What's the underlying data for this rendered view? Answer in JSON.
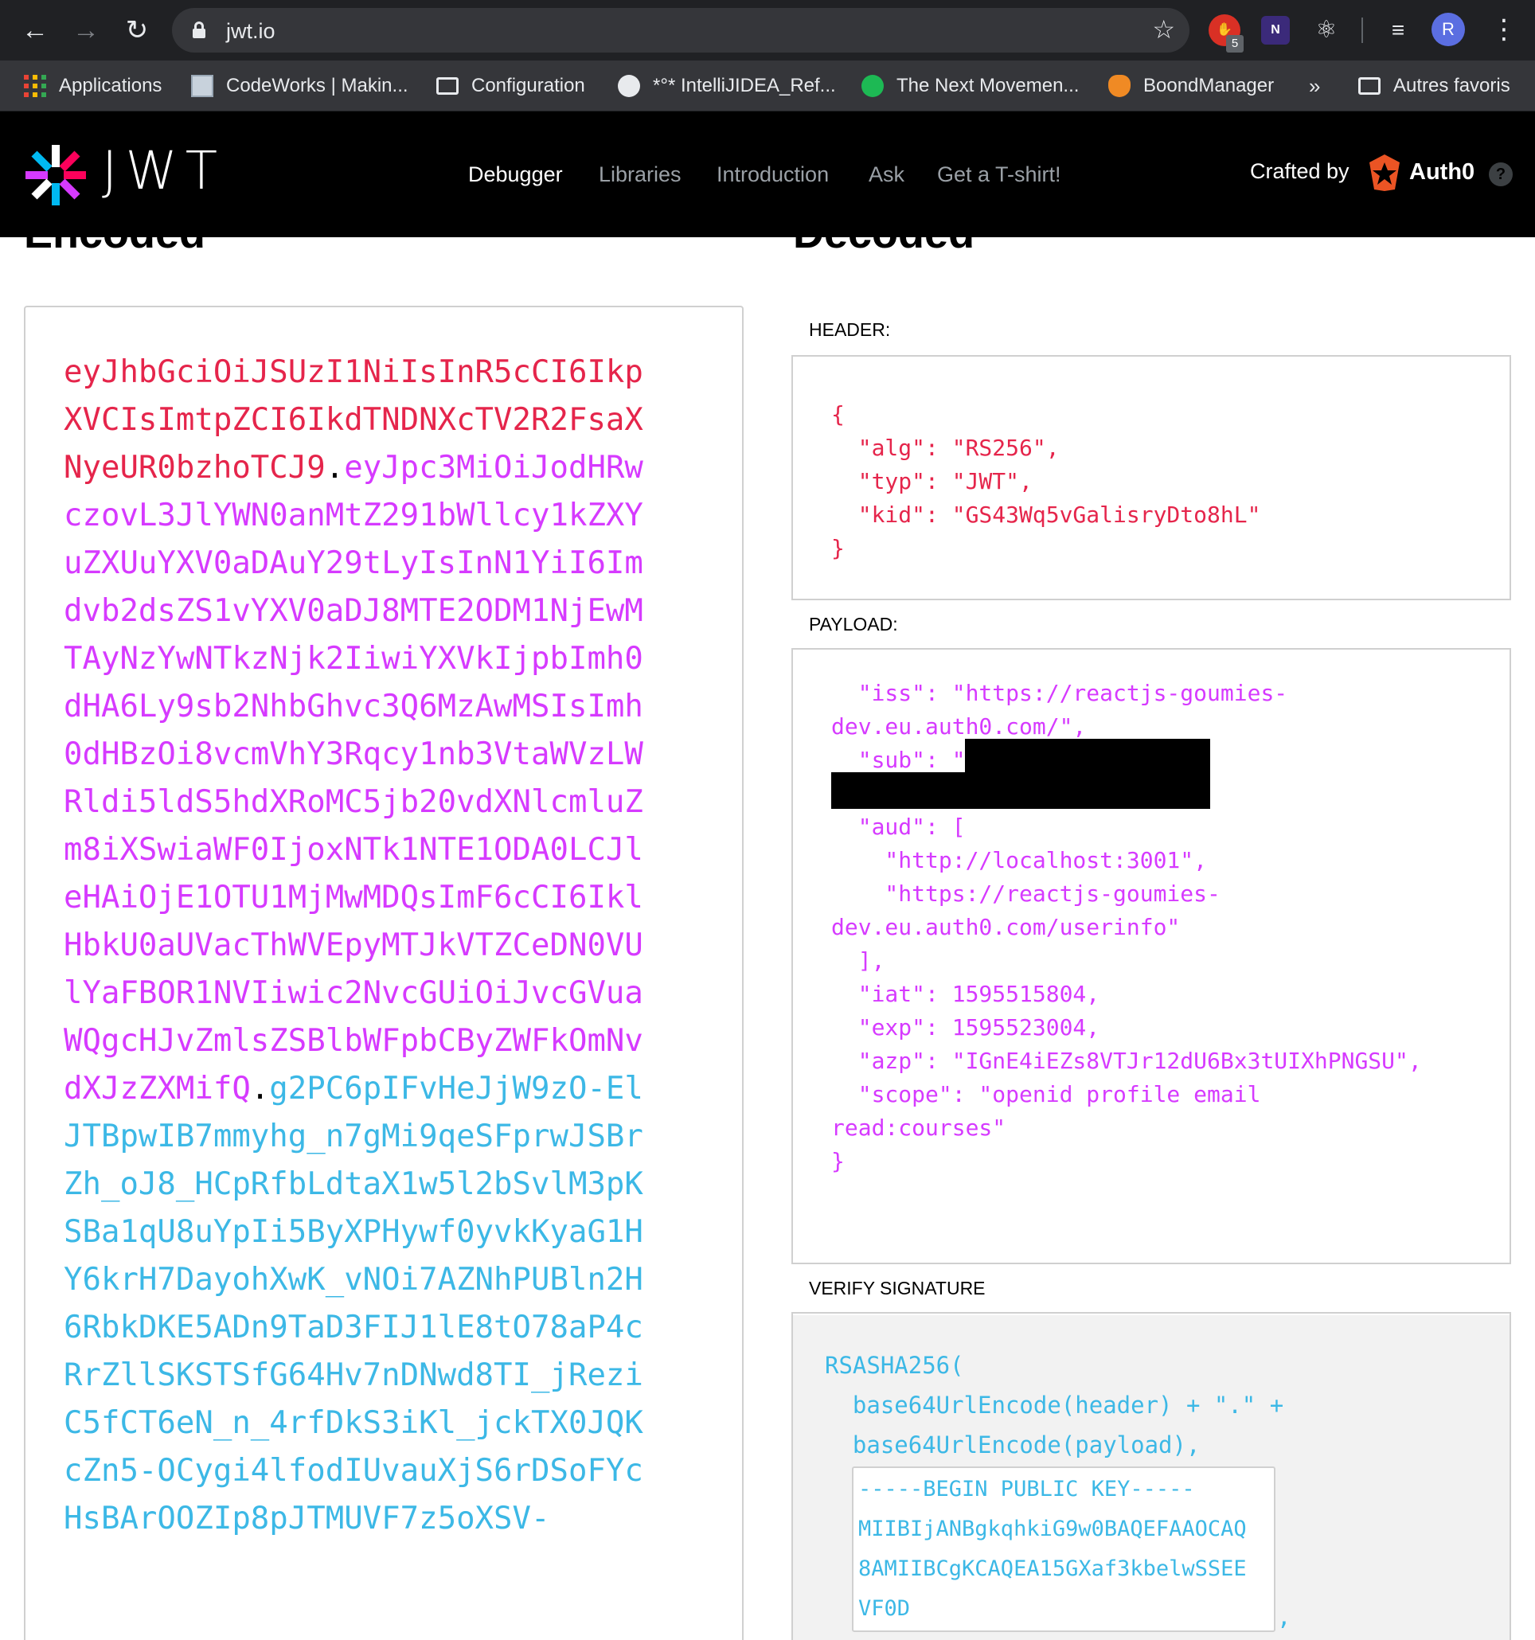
{
  "browser": {
    "url": "jwt.io",
    "extension_badge": "5",
    "avatar_letter": "R",
    "back_glyph": "←",
    "forward_glyph": "→",
    "reload_glyph": "↻",
    "star_glyph": "☆",
    "kebab_glyph": "⋮",
    "overflow_glyph": "»"
  },
  "bookmarks": [
    {
      "label": "Applications",
      "icon": "apps-grid-icon"
    },
    {
      "label": "CodeWorks | Makin...",
      "icon": "site-thumbnail-icon"
    },
    {
      "label": "Configuration",
      "icon": "folder-icon"
    },
    {
      "label": "*°* IntelliJIDEA_Ref...",
      "icon": "globe-icon"
    },
    {
      "label": "The Next Movemen...",
      "icon": "spotify-icon"
    },
    {
      "label": "BoondManager",
      "icon": "fox-icon"
    },
    {
      "label": "Autres favoris",
      "icon": "folder-icon"
    }
  ],
  "site": {
    "logo_text": "JWT",
    "nav": [
      "Debugger",
      "Libraries",
      "Introduction",
      "Ask",
      "Get a T-shirt!"
    ],
    "active_nav": "Debugger",
    "crafted_by": "Crafted by",
    "brand": "Auth0",
    "help_glyph": "?"
  },
  "encoded": {
    "title": "Encoded",
    "header_part": "eyJhbGciOiJSUzI1NiIsInR5cCI6IkpXVCIsImtpZCI6IkdTNDNXcTV2R2FsaXNyeUR0bzhoTCJ9",
    "payload_part": "eyJpc3MiOiJodHRwczovL3JlYWN0anMtZ291bWllcy1kZXYuZXUuYXV0aDAuY29tLyIsInN1YiI6Imdvb2dsZS1vYXV0aDJ8MTE2ODM1NjEwMTAyNzYwNTkzNjk2IiwiYXVkIjpbImh0dHA6Ly9sb2NhbGhvc3Q6MzAwMSIsImh0dHBzOi8vcmVhY3Rqcy1nb3VtaWVzLWRldi5ldS5hdXRoMC5jb20vdXNlcmluZm8iXSwiaWF0IjoxNTk1NTE1ODA0LCJleHAiOjE1OTU1MjMwMDQsImF6cCI6IklHbkU0aUVacThWVEpyMTJkVTZCeDN0VUlYaFBOR1NVIiwic2NvcGUiOiJvcGVuaWQgcHJvZmlsZSBlbWFpbCByZWFkOmNvdXJzZXMifQ",
    "signature_part": "g2PC6pIFvHeJjW9zO-ElJTBpwIB7mmyhg_n7gMi9qeSFprwJSBrZh_oJ8_HCpRfbLdtaX1w5l2bSvlM3pKSBa1qU8uYpIi5ByXPHywf0yvkKyaG1HY6krH7DayohXwK_vNOi7AZNhPUBln2H6RbkDKE5ADn9TaD3FIJ1lE8tO78aP4cRrZllSKSTSfG64Hv7nDNwd8TI_jReziC5fCT6eN_n_4rfDkS3iKl_jckTX0JQKcZn5-OCygi4lfodIUvauXjS6rDSoFYcHsBArOOZIp8pJTMUVF7z5oXSV-",
    "dot": "."
  },
  "decoded": {
    "title": "Decoded",
    "header_label": "HEADER:",
    "header_json": "{\n  \"alg\": \"RS256\",\n  \"typ\": \"JWT\",\n  \"kid\": \"GS43Wq5vGalisryDto8hL\"\n}",
    "payload_label": "PAYLOAD:",
    "payload_json": "  \"iss\": \"https://reactjs-goumies-\ndev.eu.auth0.com/\",\n  \"sub\": \"\n                         \",\n  \"aud\": [\n    \"http://localhost:3001\",\n    \"https://reactjs-goumies-\ndev.eu.auth0.com/userinfo\"\n  ],\n  \"iat\": 1595515804,\n  \"exp\": 1595523004,\n  \"azp\": \"IGnE4iEZs8VTJr12dU6Bx3tUIXhPNGSU\",\n  \"scope\": \"openid profile email\nread:courses\"\n}",
    "verify_label": "VERIFY SIGNATURE",
    "verify_code": "RSASHA256(\n  base64UrlEncode(header) + \".\" +\n  base64UrlEncode(payload),",
    "public_key": "-----BEGIN PUBLIC KEY-----\nMIIBIjANBgkqhkiG9w0BAQEFAAOCAQ\n8AMIIBCgKCAQEA15GXaf3kbelwSSEE\nVF0D",
    "trailing_comma": ","
  }
}
